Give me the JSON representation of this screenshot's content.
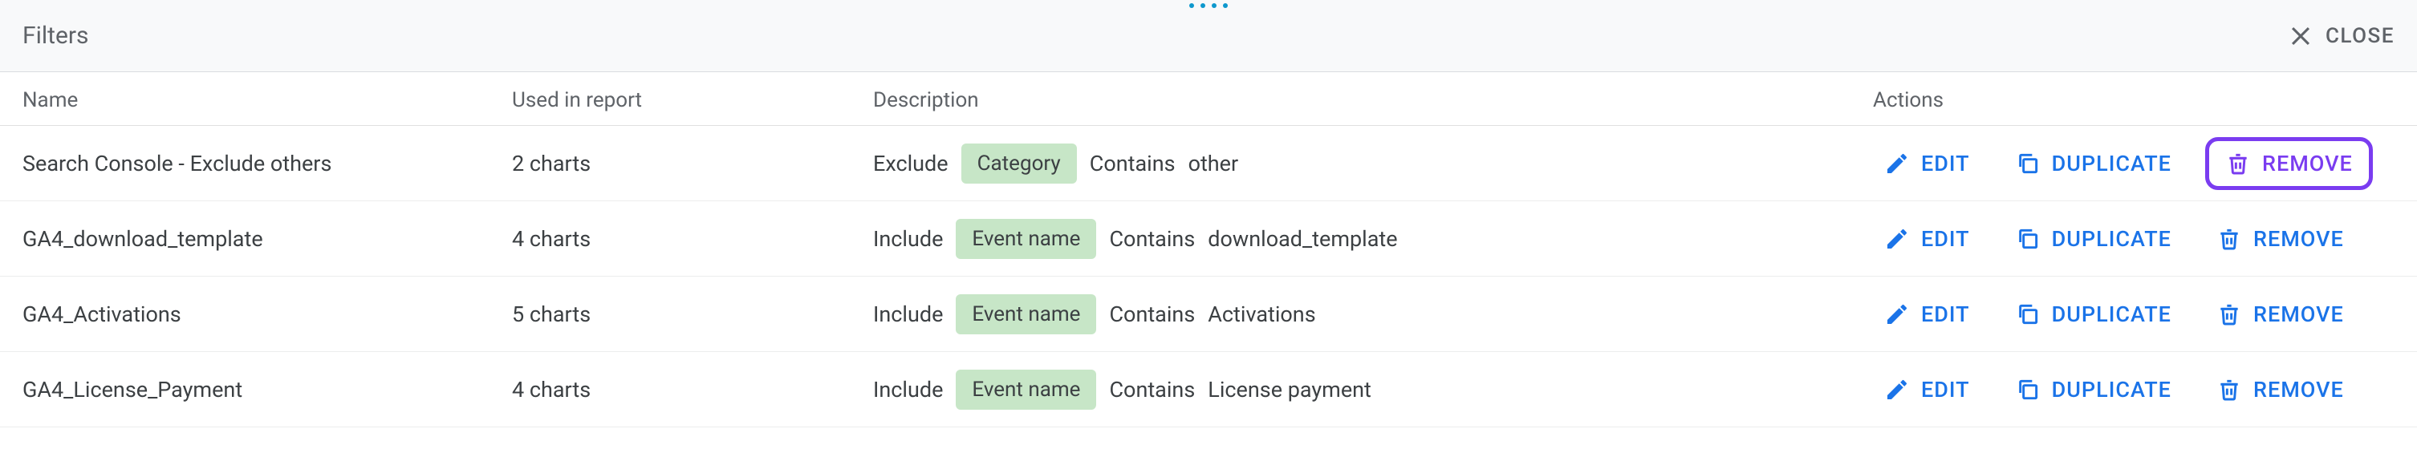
{
  "header": {
    "title": "Filters",
    "close_label": "CLOSE"
  },
  "columns": {
    "name": "Name",
    "used": "Used in report",
    "desc": "Description",
    "actions": "Actions"
  },
  "action_labels": {
    "edit": "EDIT",
    "duplicate": "DUPLICATE",
    "remove": "REMOVE"
  },
  "rows": [
    {
      "name": "Search Console - Exclude others",
      "used": "2 charts",
      "inc_exc": "Exclude",
      "chip": "Category",
      "cond": "Contains",
      "value": "other",
      "remove_highlighted": true
    },
    {
      "name": "GA4_download_template",
      "used": "4 charts",
      "inc_exc": "Include",
      "chip": "Event name",
      "cond": "Contains",
      "value": "download_template",
      "remove_highlighted": false
    },
    {
      "name": "GA4_Activations",
      "used": "5 charts",
      "inc_exc": "Include",
      "chip": "Event name",
      "cond": "Contains",
      "value": "Activations",
      "remove_highlighted": false
    },
    {
      "name": "GA4_License_Payment",
      "used": "4 charts",
      "inc_exc": "Include",
      "chip": "Event name",
      "cond": "Contains",
      "value": "License payment",
      "remove_highlighted": false
    }
  ]
}
